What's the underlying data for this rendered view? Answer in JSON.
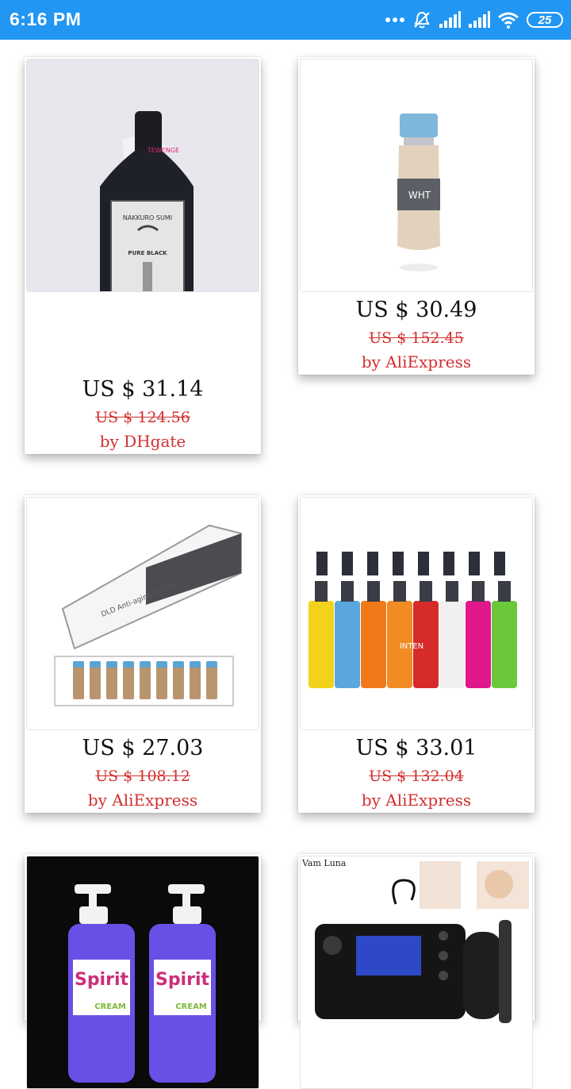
{
  "status_bar": {
    "time": "6:16 PM",
    "battery": "25"
  },
  "products": [
    {
      "price": "US $ 31.14",
      "old_price": "US $ 124.56",
      "seller": "by DHgate",
      "label_text": "TEWENGE",
      "brand_text": "NAKKURO SUMI",
      "sub_text": "PURE BLACK"
    },
    {
      "price": "US $ 30.49",
      "old_price": "US $ 152.45",
      "seller": "by AliExpress",
      "label_text": "WHT"
    },
    {
      "price": "US $ 27.03",
      "old_price": "US $ 108.12",
      "seller": "by AliExpress",
      "label_text": "DLD Anti-aging Serum"
    },
    {
      "price": "US $ 33.01",
      "old_price": "US $ 132.04",
      "seller": "by AliExpress",
      "label_text": "INTEN"
    },
    {
      "price": "",
      "old_price": "",
      "seller": "",
      "label_text": "Spirit",
      "sub_text": "CREAM"
    },
    {
      "price": "",
      "old_price": "",
      "seller": "",
      "label_text": "Vam Luna"
    }
  ]
}
